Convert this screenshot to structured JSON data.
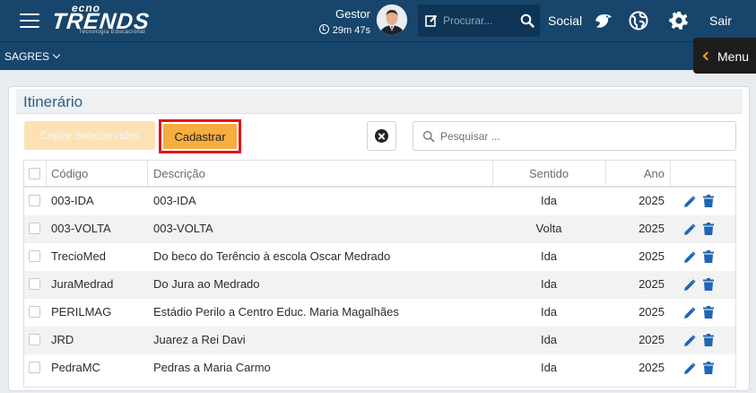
{
  "header": {
    "logo_small": "ecno",
    "logo_big": "TRENDS",
    "logo_tagline": "Tecnologia Educacional",
    "user_name": "Gestor",
    "session_timer": "29m 47s",
    "search_placeholder": "Procurar...",
    "social_label": "Social",
    "logout_label": "Sair",
    "color_primary": "#17456b"
  },
  "subheader": {
    "system_name": "SAGRES",
    "menu_label": "Menu"
  },
  "panel": {
    "title": "Itinerário",
    "copy_button": "Copiar Selecionados",
    "register_button": "Cadastrar",
    "search_placeholder": "Pesquisar ...",
    "accent_color": "#f7ad3f",
    "highlight_color": "#e0151b"
  },
  "table": {
    "columns": [
      "Código",
      "Descrição",
      "Sentido",
      "Ano"
    ],
    "rows": [
      {
        "codigo": "003-IDA",
        "descricao": "003-IDA",
        "sentido": "Ida",
        "ano": "2025"
      },
      {
        "codigo": "003-VOLTA",
        "descricao": "003-VOLTA",
        "sentido": "Volta",
        "ano": "2025"
      },
      {
        "codigo": "TrecioMed",
        "descricao": "Do beco do Terêncio à escola Oscar Medrado",
        "sentido": "Ida",
        "ano": "2025"
      },
      {
        "codigo": "JuraMedrad",
        "descricao": "Do Jura ao Medrado",
        "sentido": "Ida",
        "ano": "2025"
      },
      {
        "codigo": "PERILMAG",
        "descricao": "Estádio Perilo a Centro Educ. Maria Magalhães",
        "sentido": "Ida",
        "ano": "2025"
      },
      {
        "codigo": "JRD",
        "descricao": "Juarez a Rei Davi",
        "sentido": "Ida",
        "ano": "2025"
      },
      {
        "codigo": "PedraMC",
        "descricao": "Pedras a Maria Carmo",
        "sentido": "Ida",
        "ano": "2025"
      }
    ]
  }
}
